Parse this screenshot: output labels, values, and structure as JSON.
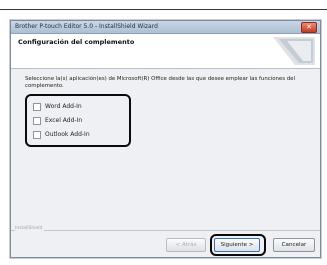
{
  "window": {
    "title": "Brother P-touch Editor 5.0 - InstallShield Wizard",
    "close_glyph": "✕"
  },
  "header": {
    "title": "Configuración del complemento"
  },
  "content": {
    "instruction": "Seleccione la(s) aplicación(es) de Microsoft(R) Office desde las que desee emplear las funciones del complemento.",
    "checkboxes": [
      {
        "label": "Word Add-In",
        "checked": false
      },
      {
        "label": "Excel Add-In",
        "checked": false
      },
      {
        "label": "Outlook Add-In",
        "checked": false
      }
    ]
  },
  "footer": {
    "brand": "InstallShield",
    "back_label": "< Atrás",
    "next_label": "Siguiente >",
    "cancel_label": "Cancelar"
  },
  "colors": {
    "titlebar": "#aebfd3",
    "window_bg": "#eef0f3",
    "highlight_outline": "#0a0a0a",
    "primary_border": "#3b6fb6"
  }
}
